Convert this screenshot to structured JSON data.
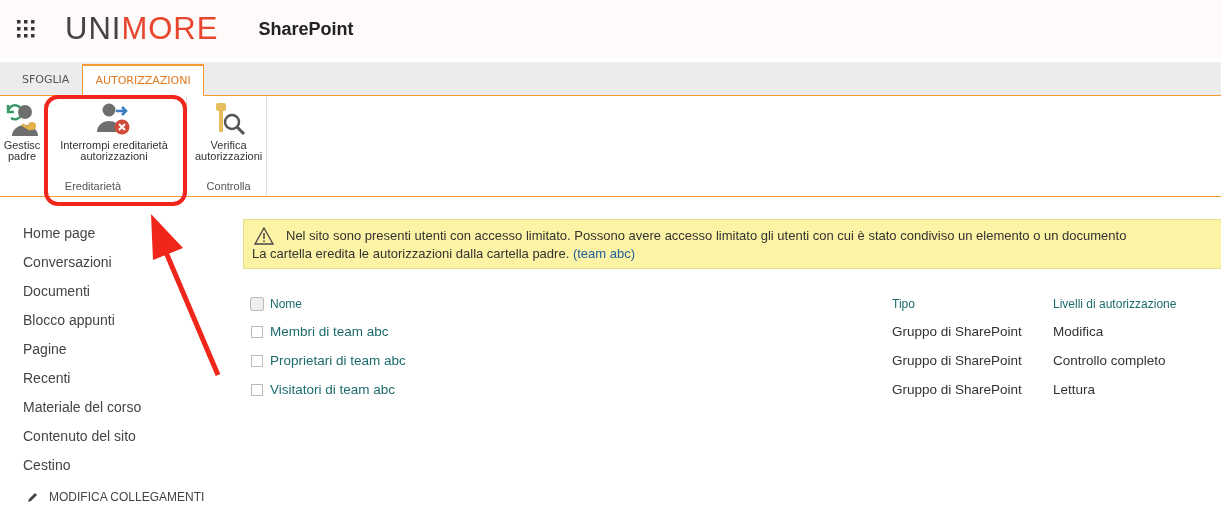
{
  "header": {
    "logo_dark": "UNI",
    "logo_accent": "MORE",
    "app_name": "SharePoint"
  },
  "ribbon_tabs": [
    {
      "label": "SFOGLIA",
      "selected": false
    },
    {
      "label": "AUTORIZZAZIONI",
      "selected": true
    }
  ],
  "ribbon_groups": [
    {
      "label": "Ereditarietà",
      "buttons": [
        {
          "kind": "manage-parent",
          "lines": [
            "Gestisc",
            "padre"
          ]
        },
        {
          "kind": "stop-inheritance",
          "lines": [
            "Interrompi ereditarietà",
            "autorizzazioni"
          ]
        }
      ]
    },
    {
      "label": "Controlla",
      "buttons": [
        {
          "kind": "check-permissions",
          "lines": [
            "Verifica",
            "autorizzazioni"
          ]
        }
      ]
    }
  ],
  "nav": [
    "Home page",
    "Conversazioni",
    "Documenti",
    "Blocco appunti",
    "Pagine",
    "Recenti",
    "Materiale del corso",
    "Contenuto del sito",
    "Cestino"
  ],
  "edit_links": "MODIFICA COLLEGAMENTI",
  "notice": {
    "text": "Nel sito sono presenti utenti con accesso limitato. Possono avere accesso limitato gli utenti con cui è stato condiviso un elemento o un documento",
    "line2": "La cartella eredita le autorizzazioni dalla cartella padre.",
    "link": "(team abc)"
  },
  "table": {
    "all_checked": false,
    "columns": [
      "Nome",
      "Tipo",
      "Livelli di autorizzazione"
    ],
    "rows": [
      {
        "name": "Membri di team abc",
        "type": "Gruppo di SharePoint",
        "level": "Modifica",
        "checked": false
      },
      {
        "name": "Proprietari di team abc",
        "type": "Gruppo di SharePoint",
        "level": "Controllo completo",
        "checked": false
      },
      {
        "name": "Visitatori di team abc",
        "type": "Gruppo di SharePoint",
        "level": "Lettura",
        "checked": false
      }
    ]
  }
}
